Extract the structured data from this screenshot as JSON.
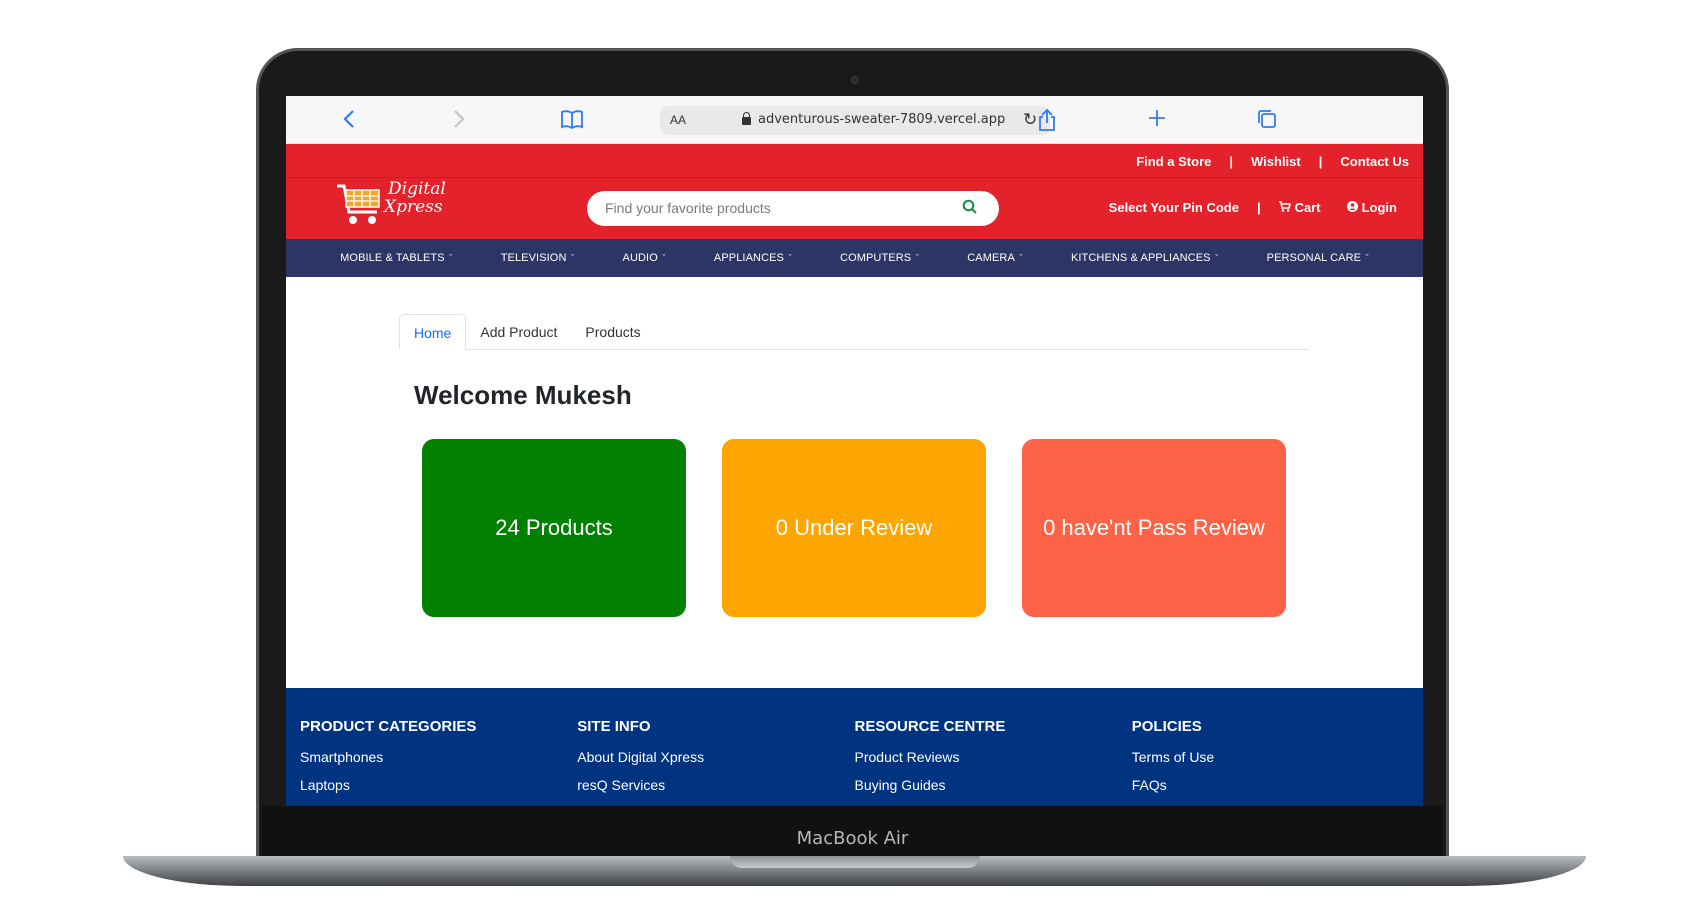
{
  "device": {
    "model_label": "MacBook Air"
  },
  "browser": {
    "text_size_label": "AA",
    "url": "adventurous-sweater-7809.vercel.app"
  },
  "site": {
    "logo_line1": "Digital",
    "logo_line2": "Xpress",
    "top_links": [
      "Find a Store",
      "Wishlist",
      "Contact Us"
    ],
    "search_placeholder": "Find your favorite products",
    "pin_code": "Select Your Pin Code",
    "cart": "Cart",
    "login": "Login",
    "categories": [
      "MOBILE & TABLETS",
      "TELEVISION",
      "AUDIO",
      "APPLIANCES",
      "COMPUTERS",
      "CAMERA",
      "KITCHENS & APPLIANCES",
      "PERSONAL CARE"
    ]
  },
  "dashboard": {
    "tabs": [
      "Home",
      "Add Product",
      "Products"
    ],
    "welcome": "Welcome Mukesh",
    "cards": {
      "products": "24 Products",
      "under_review": "0 Under Review",
      "failed_review": "0 have'nt Pass Review"
    },
    "colors": {
      "products": "#028002",
      "under_review": "#ffa500",
      "failed_review": "#ff6347"
    }
  },
  "footer": {
    "columns": [
      {
        "heading": "PRODUCT CATEGORIES",
        "links": [
          "Smartphones",
          "Laptops"
        ]
      },
      {
        "heading": "SITE INFO",
        "links": [
          "About Digital Xpress",
          "resQ Services"
        ]
      },
      {
        "heading": "RESOURCE CENTRE",
        "links": [
          "Product Reviews",
          "Buying Guides"
        ]
      },
      {
        "heading": "POLICIES",
        "links": [
          "Terms of Use",
          "FAQs"
        ]
      }
    ]
  }
}
